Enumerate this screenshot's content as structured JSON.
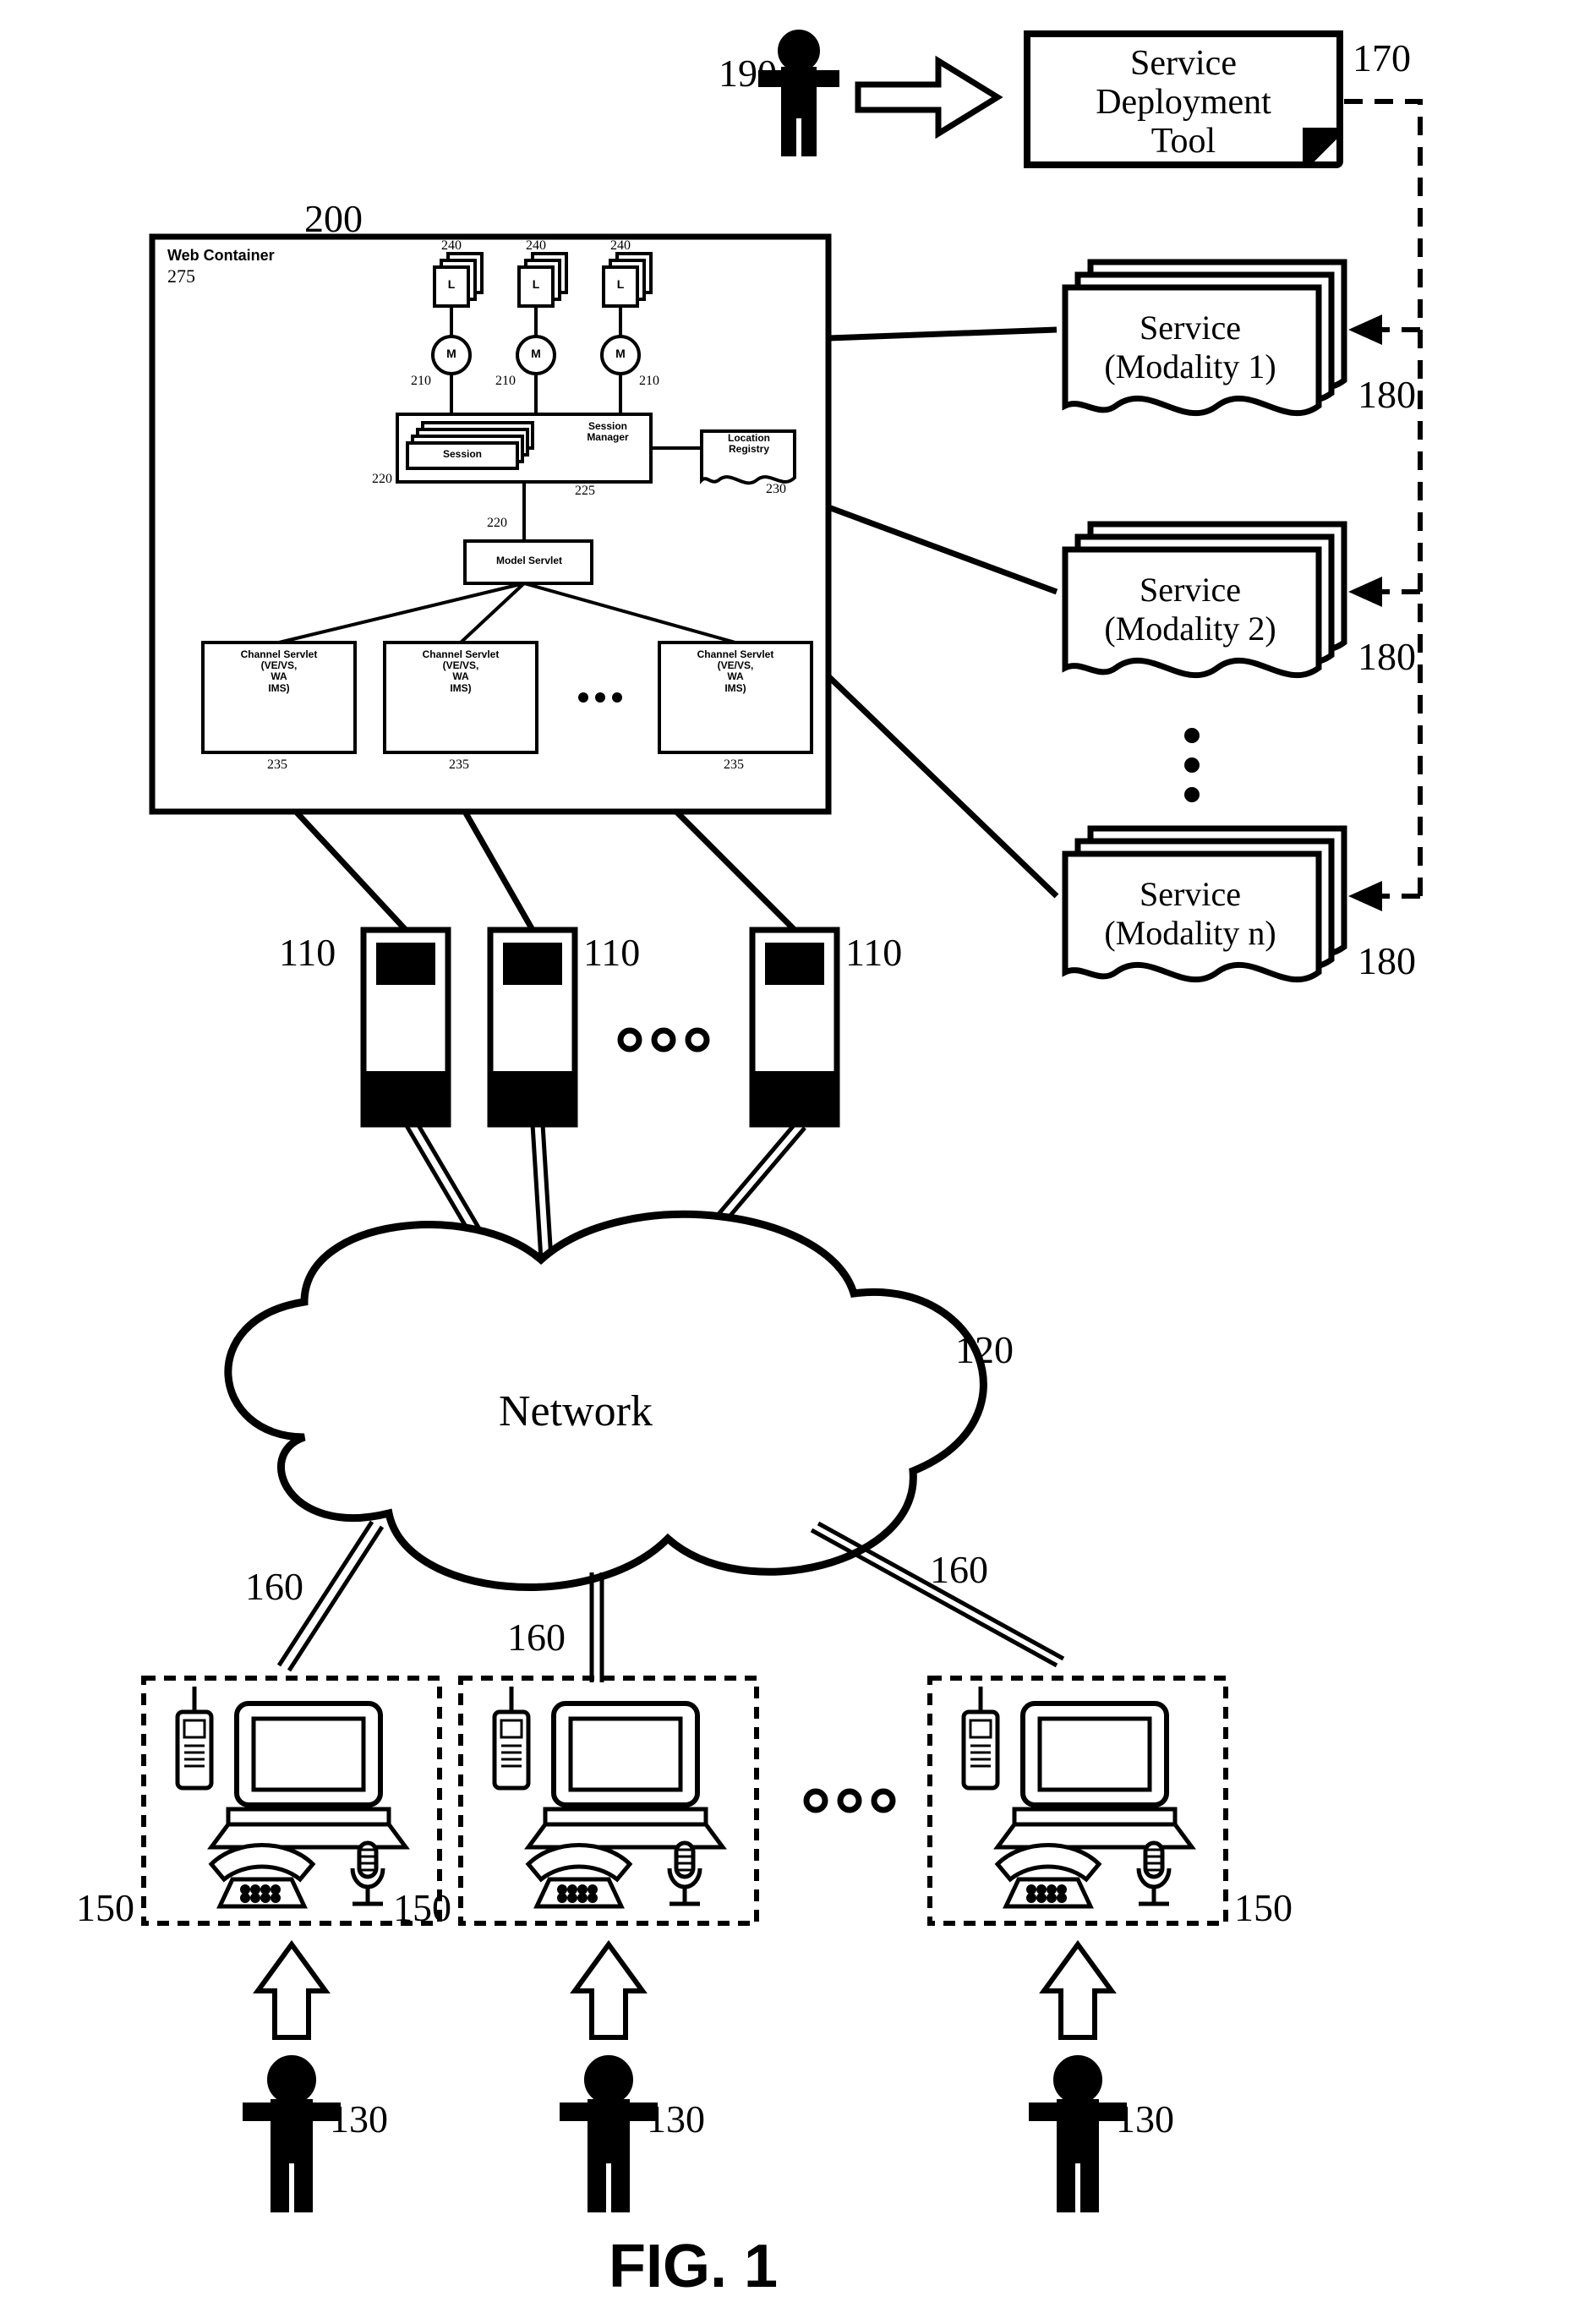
{
  "figure_label": "FIG. 1",
  "refs": {
    "deploy_tool": "170",
    "admin_user": "190",
    "service_1": "180",
    "service_2": "180",
    "service_n": "180",
    "web_container": "200",
    "server_a": "110",
    "server_b": "110",
    "server_c": "110",
    "network": "120",
    "link_a": "160",
    "link_b": "160",
    "link_c": "160",
    "client_a": "150",
    "client_b": "150",
    "client_c": "150",
    "user_a": "130",
    "user_b": "130",
    "user_c": "130",
    "wc_275": "275",
    "wc_240_a": "240",
    "wc_240_b": "240",
    "wc_240_c": "240",
    "wc_210_a": "210",
    "wc_210_b": "210",
    "wc_210_c": "210",
    "wc_220_top": "220",
    "wc_225": "225",
    "wc_230": "230",
    "wc_220_mid": "220",
    "wc_235_a": "235",
    "wc_235_b": "235",
    "wc_235_c": "235"
  },
  "deploy_tool_label": "Service\nDeployment\nTool",
  "services": {
    "s1": "Service\n(Modality 1)",
    "s2": "Service\n(Modality 2)",
    "sn": "Service\n(Modality n)"
  },
  "network_label": "Network",
  "web_container": {
    "title": "Web Container",
    "L": "L",
    "M": "M",
    "session": "Session",
    "session_manager": "Session\nManager",
    "location_registry": "Location\nRegistry",
    "model_servlet": "Model Servlet",
    "channel_servlet": "Channel Servlet\n(VE/VS,\nWA\nIMS)"
  }
}
